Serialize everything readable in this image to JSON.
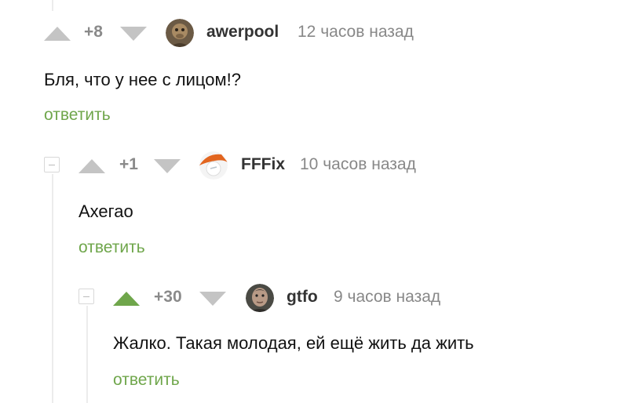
{
  "colors": {
    "accent_green": "#6fa64b",
    "vote_gray": "#c4c4c4",
    "rating_gray": "#8a8a8a",
    "username": "#333333",
    "time": "#888888"
  },
  "comments": [
    {
      "rating": "+8",
      "username": "awerpool",
      "time": "12 часов назад",
      "text": "Бля, что у нее с лицом!?",
      "reply_label": "ответить",
      "upvoted": false,
      "avatar_icon": "user-avatar-icon"
    },
    {
      "rating": "+1",
      "username": "FFFix",
      "time": "10 часов назад",
      "text": "Ахегао",
      "reply_label": "ответить",
      "upvoted": false,
      "avatar_icon": "user-avatar-icon"
    },
    {
      "rating": "+30",
      "username": "gtfo",
      "time": "9 часов назад",
      "text": "Жалко. Такая молодая, ей ещё жить да жить",
      "reply_label": "ответить",
      "upvoted": true,
      "avatar_icon": "user-avatar-icon"
    }
  ]
}
